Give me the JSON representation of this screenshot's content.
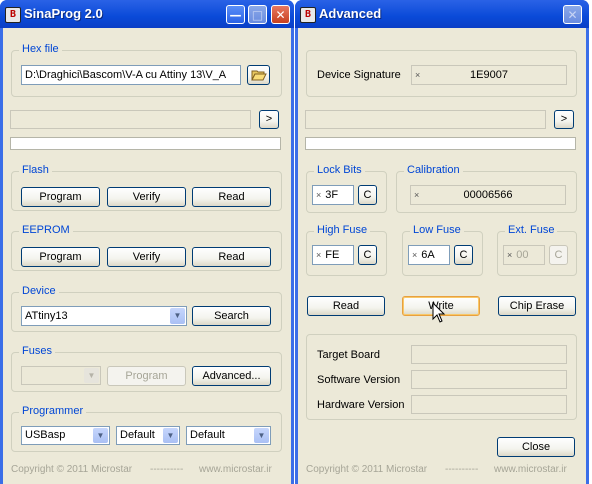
{
  "main": {
    "title": "SinaProg 2.0",
    "icon_glyph": "B",
    "hex_group": "Hex file",
    "hex_path": "D:\\Draghici\\Bascom\\V-A cu Attiny 13\\V_A",
    "arrow": ">",
    "flash_group": "Flash",
    "eeprom_group": "EEPROM",
    "program": "Program",
    "verify": "Verify",
    "read": "Read",
    "device_group": "Device",
    "device_value": "ATtiny13",
    "search": "Search",
    "fuses_group": "Fuses",
    "fuses_value": "",
    "fuses_program": "Program",
    "advanced": "Advanced...",
    "programmer_group": "Programmer",
    "programmer_value": "USBasp",
    "port_value": "Default",
    "speed_value": "Default",
    "footer_left": "Copyright © 2011 Microstar",
    "footer_dashes": "----------",
    "footer_right": "www.microstar.ir"
  },
  "advanced": {
    "title": "Advanced",
    "icon_glyph": "B",
    "signature_label": "Device Signature",
    "signature_value": "1E9007",
    "arrow": ">",
    "lock_group": "Lock Bits",
    "lock_value": "3F",
    "calibration_group": "Calibration",
    "calibration_value": "00006566",
    "high_group": "High Fuse",
    "high_value": "FE",
    "low_group": "Low Fuse",
    "low_value": "6A",
    "ext_group": "Ext. Fuse",
    "ext_value": "00",
    "c": "C",
    "x": "×",
    "read": "Read",
    "write": "Write",
    "chip_erase": "Chip Erase",
    "target_board": "Target Board",
    "software_version": "Software Version",
    "hardware_version": "Hardware Version",
    "close": "Close",
    "footer_left": "Copyright © 2011 Microstar",
    "footer_dashes": "----------",
    "footer_right": "www.microstar.ir"
  },
  "icons": [
    "minimize-icon",
    "maximize-icon",
    "close-icon",
    "folder-open-icon",
    "dropdown-arrow-icon",
    "mouse-cursor-icon"
  ],
  "colors": {
    "titlebar": "#0a4ad8",
    "client": "#ece9d8",
    "group_label": "#0046d5",
    "button_border": "#003c74"
  }
}
